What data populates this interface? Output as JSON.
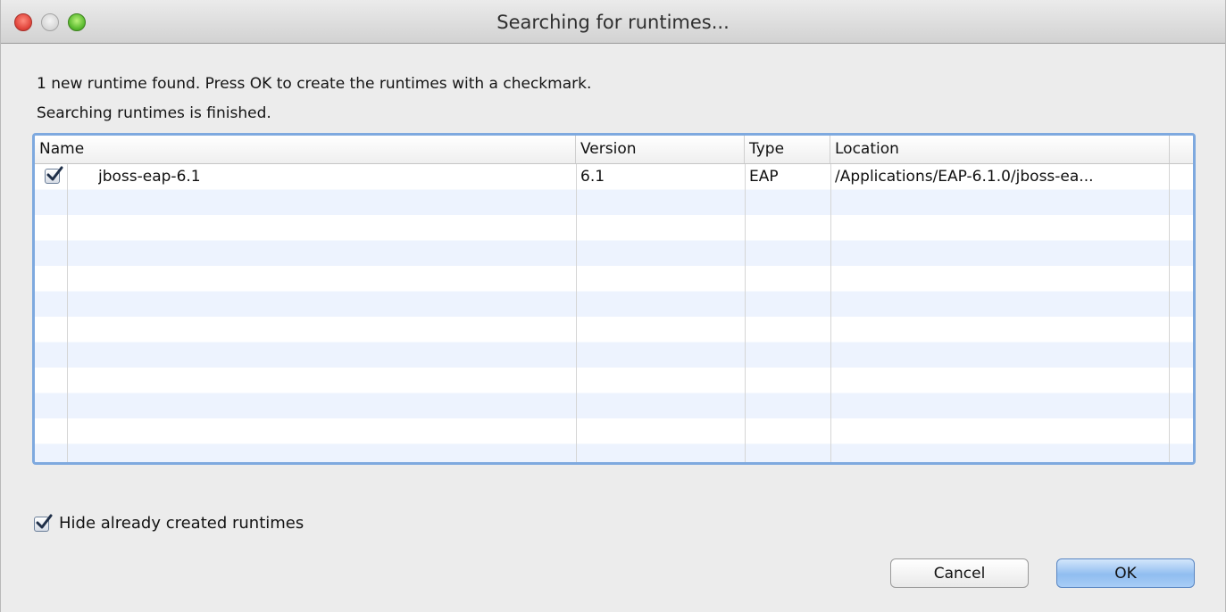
{
  "window": {
    "title": "Searching for runtimes..."
  },
  "messages": {
    "found": "1 new runtime found. Press OK to create the runtimes with a checkmark.",
    "status": "Searching runtimes is finished."
  },
  "table": {
    "columns": [
      "Name",
      "Version",
      "Type",
      "Location"
    ],
    "rows": [
      {
        "checked": true,
        "name": "jboss-eap-6.1",
        "version": "6.1",
        "type": "EAP",
        "location": "/Applications/EAP-6.1.0/jboss-ea..."
      }
    ]
  },
  "options": {
    "hide_created_label": "Hide already created runtimes",
    "hide_created_checked": true
  },
  "buttons": {
    "cancel": "Cancel",
    "ok": "OK"
  },
  "colors": {
    "accent": "#7ea9df",
    "row_stripe": "#edf3fe",
    "ok_button": "#90bdf0"
  }
}
